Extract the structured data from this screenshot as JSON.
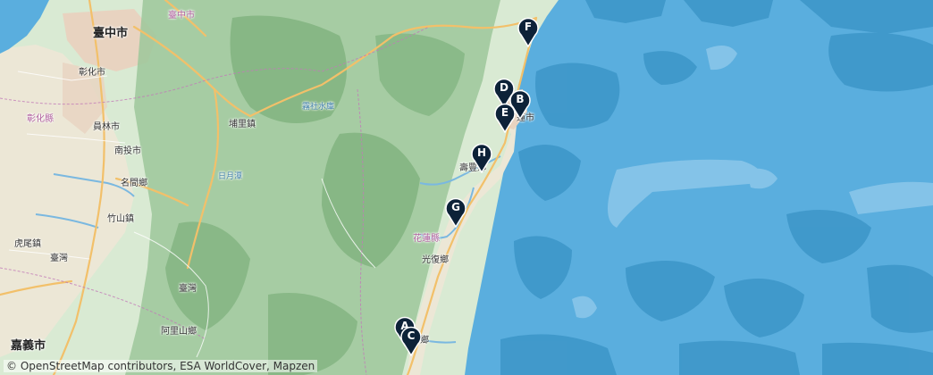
{
  "attribution": "© OpenStreetMap contributors, ESA WorldCover, Mapzen",
  "places": [
    {
      "id": "taichung-city",
      "label": "臺中市",
      "kind": "city"
    },
    {
      "id": "taichung-city-top",
      "label": "臺中市",
      "kind": "county"
    },
    {
      "id": "changhua-city",
      "label": "彰化市",
      "kind": "town"
    },
    {
      "id": "changhua-county",
      "label": "彰化縣",
      "kind": "county"
    },
    {
      "id": "yuanlin-city",
      "label": "員林市",
      "kind": "town"
    },
    {
      "id": "nantou-city",
      "label": "南投市",
      "kind": "town"
    },
    {
      "id": "puli-town",
      "label": "埔里鎮",
      "kind": "town"
    },
    {
      "id": "deji-reservoir",
      "label": "霧社水庫",
      "kind": "poi"
    },
    {
      "id": "sun-moon-lake",
      "label": "日月潭",
      "kind": "poi"
    },
    {
      "id": "mingjian-township",
      "label": "名間鄉",
      "kind": "town"
    },
    {
      "id": "zhushan-town",
      "label": "竹山鎮",
      "kind": "town"
    },
    {
      "id": "huwei-town",
      "label": "虎尾鎮",
      "kind": "town"
    },
    {
      "id": "taiwan-label-west",
      "label": "臺灣",
      "kind": "town"
    },
    {
      "id": "taiwan-label-mid",
      "label": "臺灣",
      "kind": "town"
    },
    {
      "id": "alishan-township",
      "label": "阿里山鄉",
      "kind": "town"
    },
    {
      "id": "chiayi-city",
      "label": "嘉義市",
      "kind": "city"
    },
    {
      "id": "hualien-county",
      "label": "花蓮縣",
      "kind": "county"
    },
    {
      "id": "guangfu-township",
      "label": "光復鄉",
      "kind": "town"
    },
    {
      "id": "shoufeng-township",
      "label": "壽豐鄉",
      "kind": "town"
    },
    {
      "id": "hualien-city",
      "label": "蓮市",
      "kind": "town"
    },
    {
      "id": "ruisui-township",
      "label": "鄉",
      "kind": "town"
    }
  ],
  "markers": [
    {
      "letter": "F"
    },
    {
      "letter": "D"
    },
    {
      "letter": "B"
    },
    {
      "letter": "E"
    },
    {
      "letter": "H"
    },
    {
      "letter": "G"
    },
    {
      "letter": "A"
    },
    {
      "letter": "C"
    }
  ],
  "colors": {
    "sea": "#5aaede",
    "sea_deep": "#3e97c9",
    "sea_shallow": "#8cc7ea",
    "land": "#d9ead3",
    "mountain": "#9cc79a",
    "plain": "#ece7d6",
    "urban": "#e8d3c0",
    "road": "#f2c06a",
    "marker": "#0d2238"
  }
}
